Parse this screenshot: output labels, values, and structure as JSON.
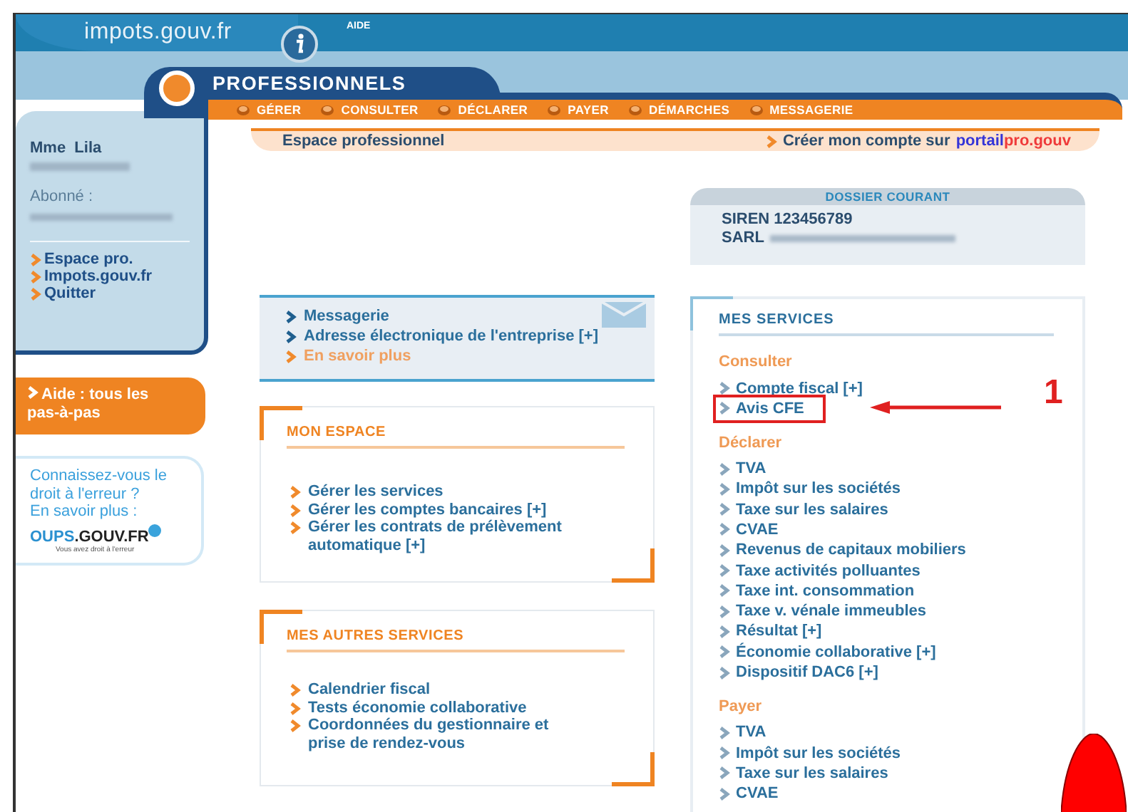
{
  "header": {
    "site_name": "impots.gouv.fr",
    "help_link": "AIDE",
    "section_title": "PROFESSIONNELS"
  },
  "nav_menu": [
    {
      "label": "GÉRER"
    },
    {
      "label": "CONSULTER"
    },
    {
      "label": "DÉCLARER"
    },
    {
      "label": "PAYER"
    },
    {
      "label": "DÉMARCHES"
    },
    {
      "label": "MESSAGERIE"
    }
  ],
  "sidebar": {
    "user_name": "Mme  Lila",
    "subscriber_label": "Abonné :",
    "links": [
      "Espace pro.",
      "Impots.gouv.fr",
      "Quitter"
    ],
    "help_button": "Aide : tous les pas-à-pas",
    "promo": {
      "text": "Connaissez-vous le droit à l'erreur ?",
      "link": "En savoir plus :",
      "logo_part_1": "OUPS",
      "logo_part_2": ".GOUV.FR",
      "logo_tagline": "Vous avez droit à l'erreur"
    }
  },
  "breadcrumb": {
    "title": "Espace professionnel",
    "create_account": "Créer mon compte sur",
    "portal_part_1": "portail",
    "portal_part_2": "pro.gouv"
  },
  "dossier": {
    "title": "DOSSIER COURANT",
    "siren": "SIREN 123456789",
    "company_prefix": "SARL"
  },
  "messages_box": {
    "links": [
      {
        "label": "Messagerie",
        "kind": "primary"
      },
      {
        "label": "Adresse électronique de l'entreprise [+]",
        "kind": "primary"
      },
      {
        "label": "En savoir plus",
        "kind": "more"
      }
    ]
  },
  "mon_espace": {
    "title": "MON ESPACE",
    "links": [
      "Gérer les services",
      "Gérer les comptes bancaires [+]",
      "Gérer les contrats de prélèvement automatique [+]"
    ]
  },
  "autres_services": {
    "title": "MES AUTRES SERVICES",
    "links": [
      "Calendrier fiscal",
      "Tests économie collaborative",
      "Coordonnées du gestionnaire et prise de rendez-vous"
    ]
  },
  "mes_services": {
    "title": "MES SERVICES",
    "callout_number": "1",
    "groups": [
      {
        "title": "Consulter",
        "items": [
          {
            "label": "Compte fiscal [+]",
            "highlighted": false
          },
          {
            "label": "Avis CFE",
            "highlighted": true
          }
        ]
      },
      {
        "title": "Déclarer",
        "items": [
          {
            "label": "TVA",
            "highlighted": false
          },
          {
            "label": "Impôt sur les sociétés",
            "highlighted": false
          },
          {
            "label": "Taxe sur les salaires",
            "highlighted": false
          },
          {
            "label": "CVAE",
            "highlighted": false
          },
          {
            "label": "Revenus de capitaux mobiliers",
            "highlighted": false
          },
          {
            "label": "Taxe activités polluantes",
            "highlighted": false
          },
          {
            "label": "Taxe int. consommation",
            "highlighted": false
          },
          {
            "label": "Taxe v. vénale immeubles",
            "highlighted": false
          },
          {
            "label": "Résultat [+]",
            "highlighted": false
          },
          {
            "label": "Économie collaborative [+]",
            "highlighted": false
          },
          {
            "label": "Dispositif DAC6 [+]",
            "highlighted": false
          }
        ]
      },
      {
        "title": "Payer",
        "items": [
          {
            "label": "TVA",
            "highlighted": false
          },
          {
            "label": "Impôt sur les sociétés",
            "highlighted": false
          },
          {
            "label": "Taxe sur les salaires",
            "highlighted": false
          },
          {
            "label": "CVAE",
            "highlighted": false
          }
        ]
      }
    ]
  }
}
